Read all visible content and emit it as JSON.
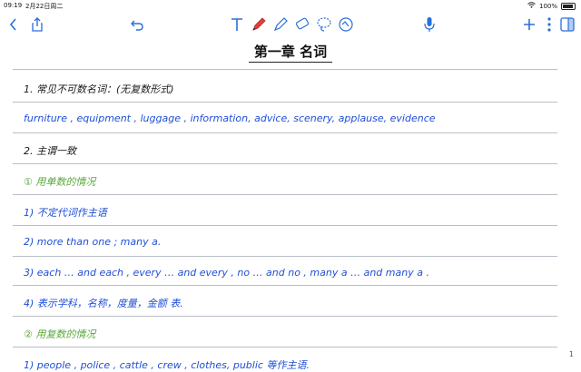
{
  "status_bar": {
    "time": "09:19",
    "date": "2月22日周二",
    "battery": "100%"
  },
  "toolbar": {
    "left": [
      {
        "name": "back-icon",
        "glyph": "‹"
      },
      {
        "name": "share-icon"
      },
      {
        "name": "undo-icon",
        "glyph": "↶"
      }
    ],
    "tools": [
      "text-tool-icon",
      "pen-tool-icon",
      "highlighter-tool-icon",
      "eraser-tool-icon",
      "lasso-tool-icon",
      "shapes-tool-icon"
    ],
    "right": [
      "microphone-icon",
      "add-page-icon",
      "more-icon",
      "page-sidebar-icon"
    ],
    "accent_color": "#e0413a"
  },
  "note": {
    "title": "第一章 名词",
    "lines": [
      {
        "text": "1. 常见不可数名词：(无复数形式)",
        "color": "black"
      },
      {
        "text": "furniture , equipment , luggage , information, advice, scenery, applause, evidence",
        "color": "blue"
      },
      {
        "text": "2. 主谓一致",
        "color": "black"
      },
      {
        "text": "① 用单数的情况",
        "color": "green"
      },
      {
        "text": "1) 不定代词作主语",
        "color": "blue"
      },
      {
        "text": "2) more than one ; many a.",
        "color": "blue"
      },
      {
        "text": "3) each … and each , every … and every , no … and no , many a … and many a .",
        "color": "blue"
      },
      {
        "text": "4) 表示学科，名称，度量，金额 表.",
        "color": "blue"
      },
      {
        "text": "② 用复数的情况",
        "color": "green"
      },
      {
        "text": "1) people , police , cattle , crew , clothes, public 等作主语.",
        "color": "blue"
      }
    ],
    "side_page_number": "1"
  }
}
